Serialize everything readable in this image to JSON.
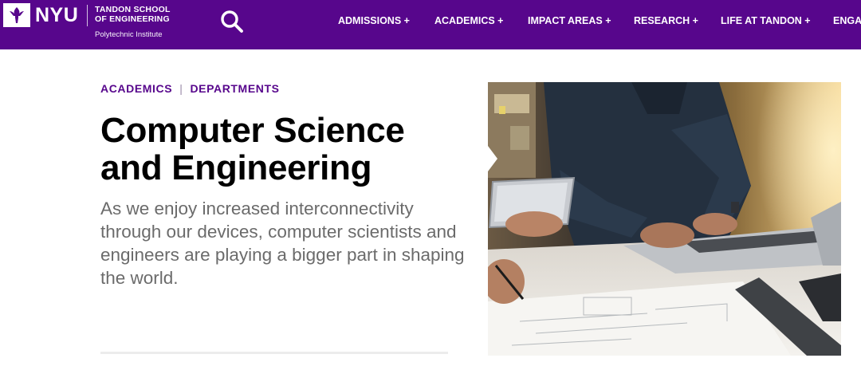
{
  "header": {
    "logo_text": "NYU",
    "school_line1": "TANDON SCHOOL",
    "school_line2": "OF ENGINEERING",
    "school_sub": "Polytechnic Institute",
    "search_icon": "search-icon",
    "background_color": "#57068c"
  },
  "nav": {
    "items": [
      {
        "label": "ADMISSIONS +"
      },
      {
        "label": "ACADEMICS +"
      },
      {
        "label": "IMPACT AREAS +"
      },
      {
        "label": "RESEARCH +"
      },
      {
        "label": "LIFE AT TANDON +"
      },
      {
        "label": "ENGA"
      }
    ]
  },
  "breadcrumb": {
    "items": [
      {
        "label": "ACADEMICS"
      },
      {
        "label": "DEPARTMENTS"
      }
    ],
    "separator": "|"
  },
  "page": {
    "title": "Computer Science and Engineering",
    "lede": "As we enjoy increased interconnectivity through our devices, computer scientists and engineers are playing a bigger part in shaping the world."
  },
  "colors": {
    "brand_purple": "#57068c",
    "text_gray": "#6b6b6b"
  }
}
